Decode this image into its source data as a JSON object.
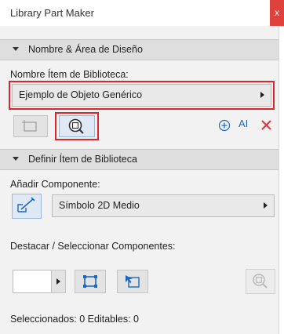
{
  "window": {
    "title": "Library Part Maker",
    "close_glyph": "x"
  },
  "section1": {
    "heading": "Nombre & Área de Diseño",
    "field_label": "Nombre Ítem de Biblioteca:",
    "item_name": "Ejemplo de Objeto Genérico"
  },
  "section2": {
    "heading": "Definir Ítem de Biblioteca",
    "add_label": "Añadir Componente:",
    "component_value": "Símbolo 2D Medio",
    "highlight_label": "Destacar / Seleccionar Componentes:",
    "status": "Seleccionados: 0 Editables: 0"
  },
  "toolbar": {
    "text_size_glyph": "AI"
  },
  "colors": {
    "accent_red": "#e0242b",
    "accent_blue": "#1a66c4",
    "delete_red": "#e8383d"
  }
}
